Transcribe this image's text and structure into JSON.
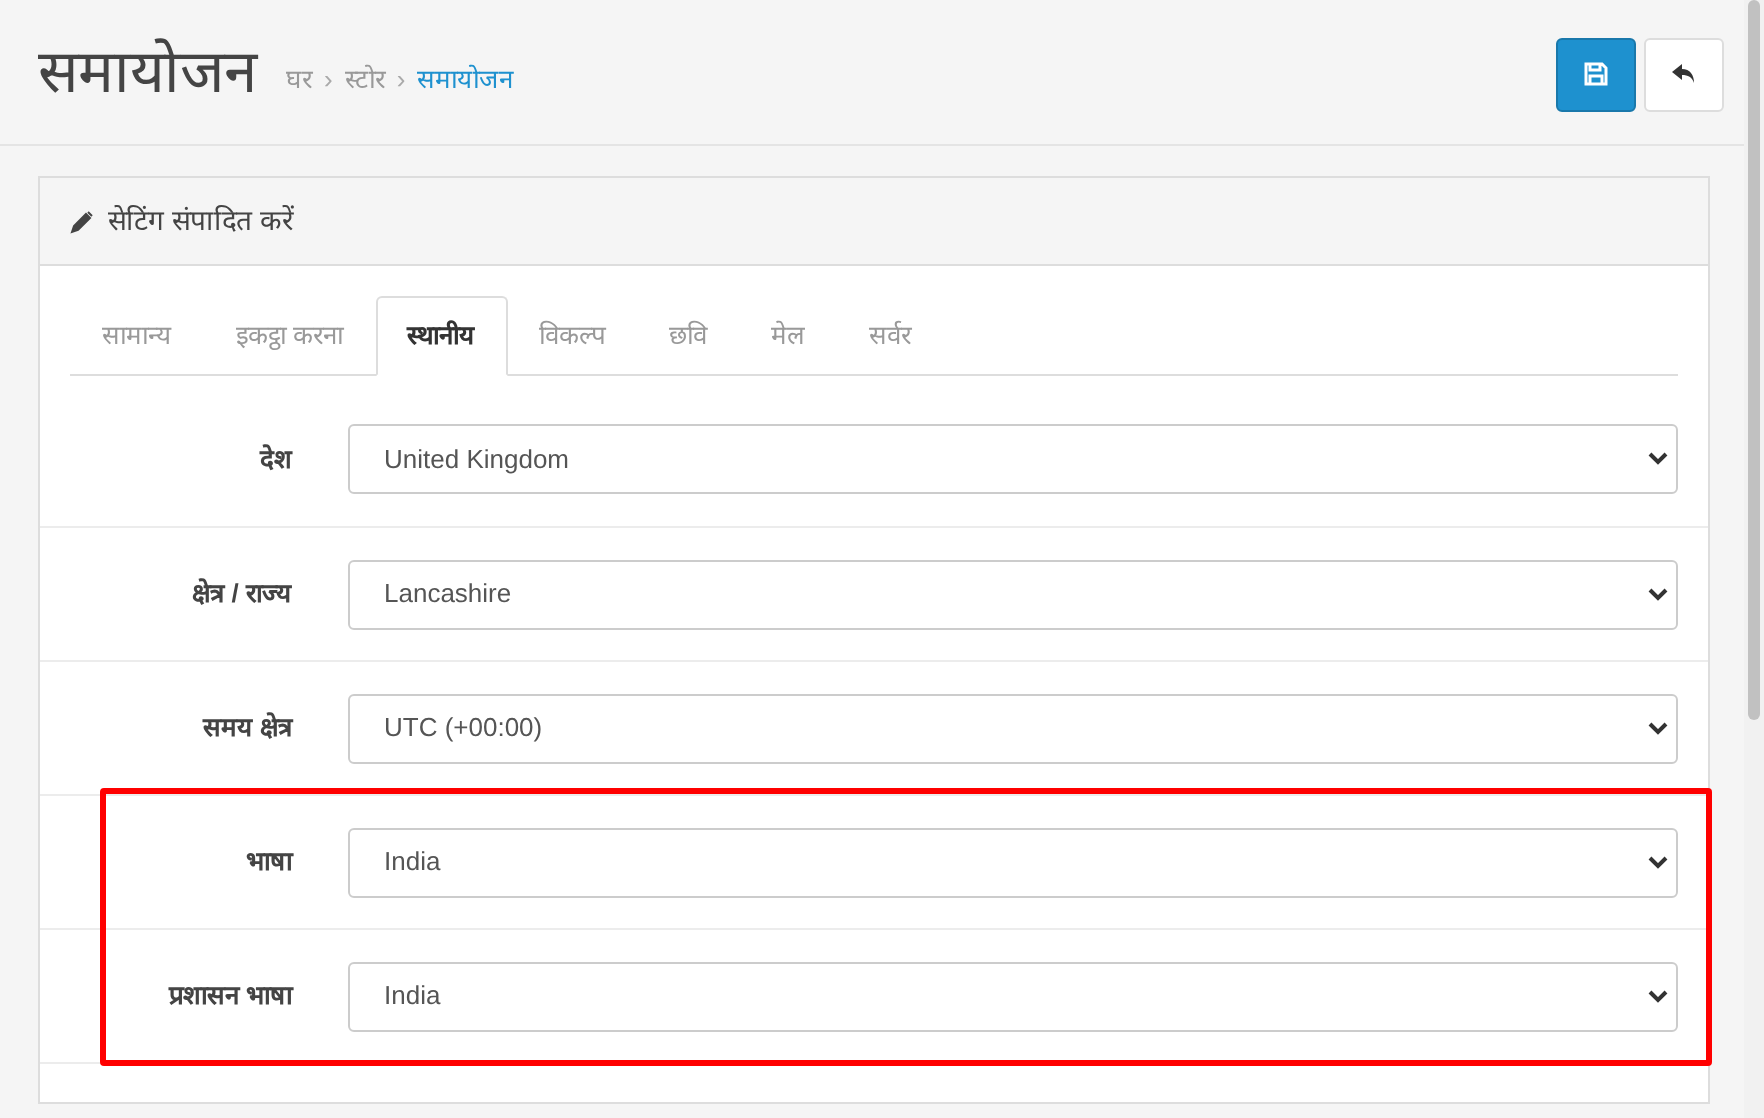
{
  "page_title": "समायोजन",
  "breadcrumb": [
    {
      "label": "घर",
      "current": false
    },
    {
      "label": "स्टोर",
      "current": false
    },
    {
      "label": "समायोजन",
      "current": true
    }
  ],
  "breadcrumb_separator": "›",
  "panel": {
    "title": "सेटिंग संपादित करें"
  },
  "tabs": [
    {
      "label": "सामान्य",
      "selected": false
    },
    {
      "label": "इकट्ठा करना",
      "selected": false
    },
    {
      "label": "स्थानीय",
      "selected": true
    },
    {
      "label": "विकल्प",
      "selected": false
    },
    {
      "label": "छवि",
      "selected": false
    },
    {
      "label": "मेल",
      "selected": false
    },
    {
      "label": "सर्वर",
      "selected": false
    }
  ],
  "fields": [
    {
      "label": "देश",
      "value": "United Kingdom",
      "highlighted": false
    },
    {
      "label": "क्षेत्र / राज्य",
      "value": "Lancashire",
      "highlighted": false
    },
    {
      "label": "समय क्षेत्र",
      "value": "UTC (+00:00)",
      "highlighted": false
    },
    {
      "label": "भाषा",
      "value": "India",
      "highlighted": true
    },
    {
      "label": "प्रशासन भाषा",
      "value": "India",
      "highlighted": true
    }
  ]
}
